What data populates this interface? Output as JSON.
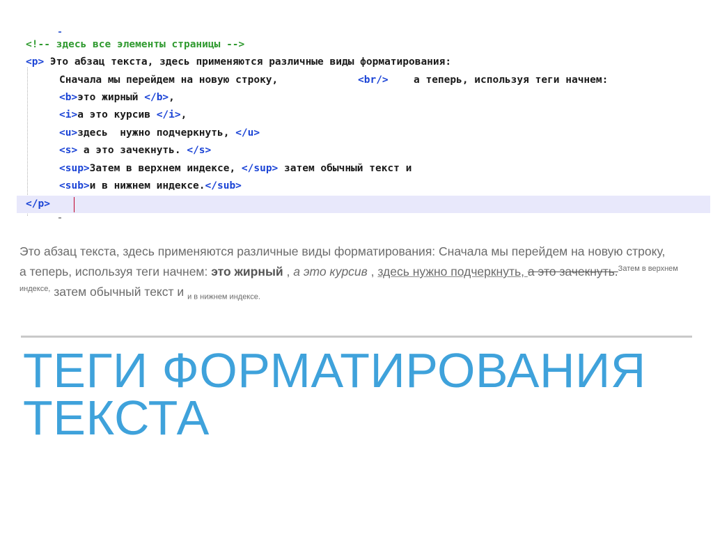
{
  "code": {
    "comment": "<!-- здесь все элементы страницы -->",
    "p_open": "<p>",
    "p_text": " Это абзац текста, здесь применяются различные виды форматирования:",
    "line_br_before": "Сначала мы перейдем на новую строку,",
    "br_tag": "<br/>",
    "line_br_after": "а теперь, используя теги начнем:",
    "b_open": "<b>",
    "b_text": "это жирный ",
    "b_close": "</b>",
    "b_after": ",",
    "i_open": "<i>",
    "i_text": "а это курсив ",
    "i_close": "</i>",
    "i_after": ",",
    "u_open": "<u>",
    "u_text": "здесь  нужно подчеркнуть, ",
    "u_close": "</u>",
    "s_open": "<s>",
    "s_text": " а это зачекнуть. ",
    "s_close": "</s>",
    "sup_open": "<sup>",
    "sup_text": "Затем в верхнем индексе, ",
    "sup_close": "</sup>",
    "sup_after": " затем обычный текст и",
    "sub_open": "<sub>",
    "sub_text": "и в нижнем индексе.",
    "sub_close": "</sub>",
    "p_close": "</p>"
  },
  "rendered": {
    "line1": "Это абзац текста, здесь применяются различные виды форматирования: Сначала мы перейдем на новую строку,",
    "lead": "а теперь, используя теги начнем: ",
    "bold": "это жирный",
    "sep1": " , ",
    "italic": "а это курсив",
    "sep2": " , ",
    "underline": "здесь нужно подчеркнуть, ",
    "strike": "а это зачекнуть.",
    "sup": "Затем в верхнем индексе,",
    "normal": " затем обычный текст и ",
    "sub": "и в нижнем индексе."
  },
  "title": {
    "line1": "ТЕГИ ФОРМАТИРОВАНИЯ",
    "line2": "ТЕКСТА"
  }
}
